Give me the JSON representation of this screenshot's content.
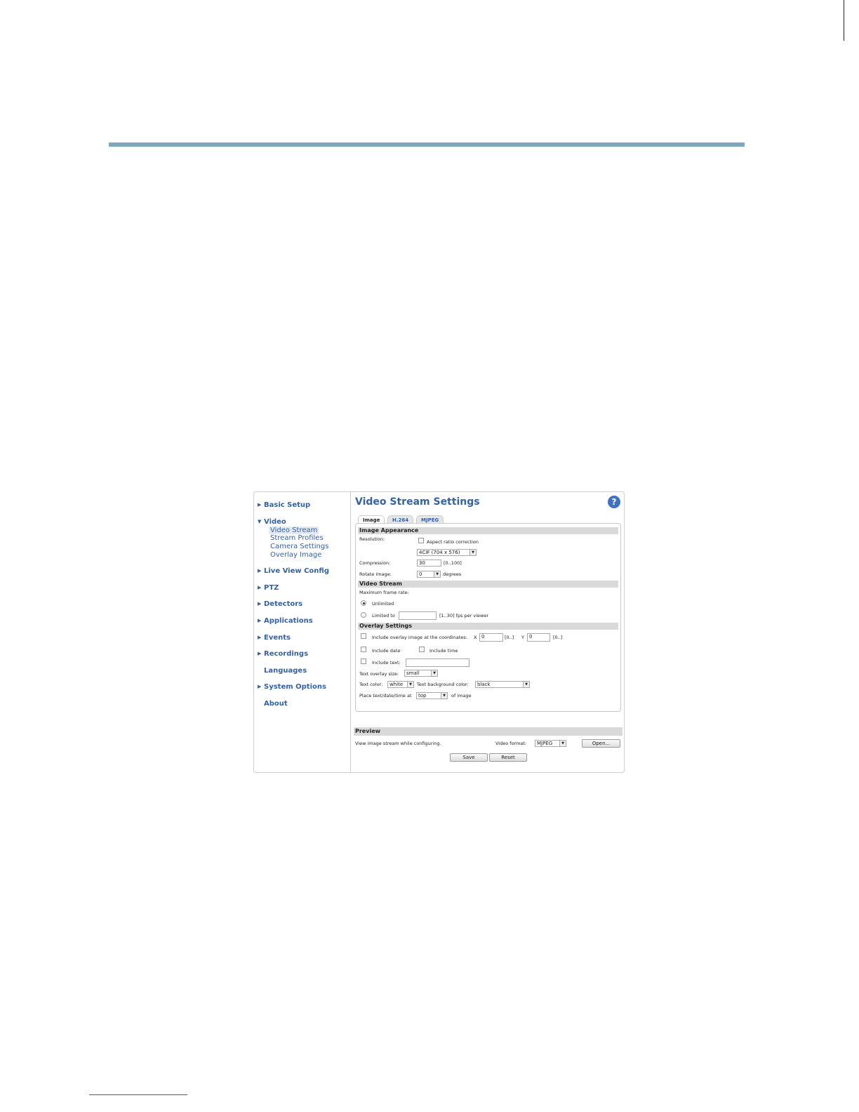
{
  "nav": {
    "basic_setup": "Basic Setup",
    "video": "Video",
    "video_sub": [
      "Video Stream",
      "Stream Profiles",
      "Camera Settings",
      "Overlay Image"
    ],
    "live_view": "Live View Config",
    "ptz": "PTZ",
    "detectors": "Detectors",
    "applications": "Applications",
    "events": "Events",
    "recordings": "Recordings",
    "languages": "Languages",
    "system_options": "System Options",
    "about": "About"
  },
  "header": {
    "title": "Video Stream Settings",
    "help": "?"
  },
  "tabs": [
    "Image",
    "H.264",
    "MJPEG"
  ],
  "image_appearance": {
    "title": "Image Appearance",
    "resolution_label": "Resolution:",
    "aspect_label": "Aspect ratio correction",
    "resolution_value": "4CIF (704 x 576)",
    "compression_label": "Compression:",
    "compression_value": "30",
    "compression_range": "[0..100]",
    "rotate_label": "Rotate image:",
    "rotate_value": "0",
    "rotate_unit": "degrees"
  },
  "video_stream": {
    "title": "Video Stream",
    "max_fps_label": "Maximum frame rate:",
    "unlimited": "Unlimited",
    "limited_to": "Limited to",
    "limited_value": "",
    "limited_range": "[1..30] fps per viewer"
  },
  "overlay": {
    "title": "Overlay Settings",
    "include_overlay": "Include overlay image at the coordinates:",
    "x_label": "X",
    "x_value": "0",
    "x_range": "[0..]",
    "y_label": "Y",
    "y_value": "0",
    "y_range": "[0..]",
    "include_date": "Include date",
    "include_time": "Include time",
    "include_text": "Include text:",
    "text_value": "",
    "size_label": "Text overlay size:",
    "size_value": "small",
    "color_label": "Text color:",
    "color_value": "white",
    "bg_label": "Text background color:",
    "bg_value": "black",
    "place_label": "Place text/date/time at",
    "place_value": "top",
    "place_suffix": "of image"
  },
  "preview": {
    "title": "Preview",
    "desc": "View image stream while configuring.",
    "format_label": "Video format:",
    "format_value": "MJPEG",
    "open_button": "Open..."
  },
  "actions": {
    "save": "Save",
    "reset": "Reset"
  },
  "colors": {
    "accent_rule": "#7ba8bd",
    "link_blue": "#3561a5",
    "section_gray": "#d9d9d9"
  }
}
